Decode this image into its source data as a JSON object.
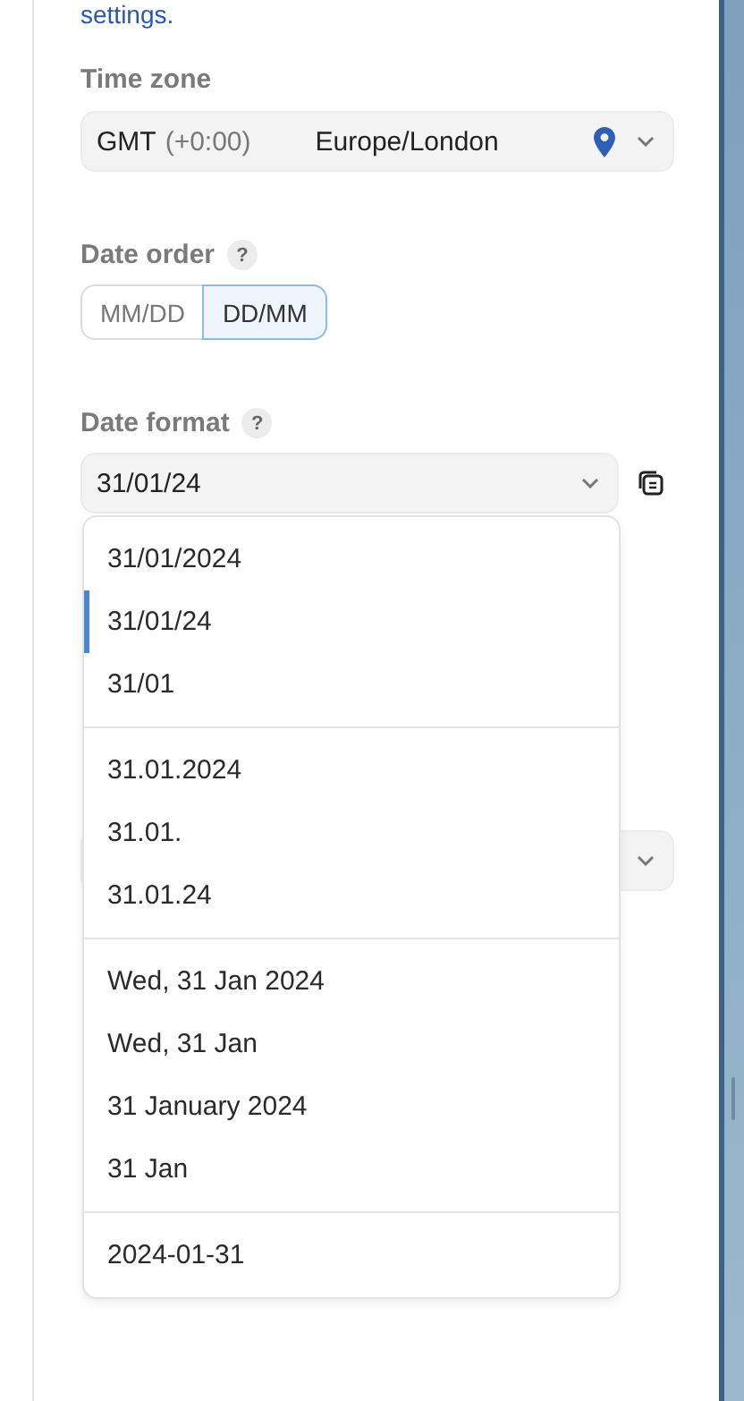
{
  "intro_link": "settings.",
  "time_zone": {
    "label": "Time zone",
    "abbr": "GMT",
    "offset": "(+0:00)",
    "zone": "Europe/London"
  },
  "date_order": {
    "label": "Date order",
    "help": "?",
    "options": [
      {
        "label": "MM/DD",
        "selected": false
      },
      {
        "label": "DD/MM",
        "selected": true
      }
    ]
  },
  "date_format": {
    "label": "Date format",
    "help": "?",
    "value": "31/01/24",
    "groups": [
      {
        "options": [
          {
            "label": "31/01/2024",
            "selected": false
          },
          {
            "label": "31/01/24",
            "selected": true
          },
          {
            "label": "31/01",
            "selected": false
          }
        ]
      },
      {
        "options": [
          {
            "label": "31.01.2024",
            "selected": false
          },
          {
            "label": "31.01.",
            "selected": false
          },
          {
            "label": "31.01.24",
            "selected": false
          }
        ]
      },
      {
        "options": [
          {
            "label": "Wed, 31 Jan 2024",
            "selected": false
          },
          {
            "label": "Wed, 31 Jan",
            "selected": false
          },
          {
            "label": "31 January 2024",
            "selected": false
          },
          {
            "label": "31 Jan",
            "selected": false
          }
        ]
      },
      {
        "options": [
          {
            "label": "2024-01-31",
            "selected": false
          }
        ]
      }
    ]
  }
}
